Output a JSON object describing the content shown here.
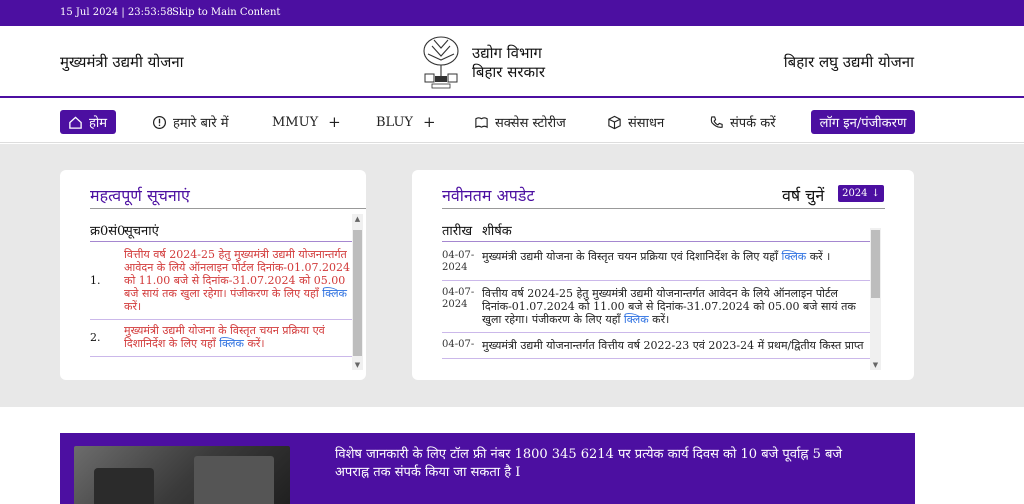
{
  "topbar": {
    "datetime": "15 Jul 2024 | 23:53:58",
    "skip_link": "Skip to Main Content"
  },
  "header": {
    "left_title": "मुख्यमंत्री उद्यमी योजना",
    "logo_line1": "उद्योग विभाग",
    "logo_line2": "बिहार सरकार",
    "right_title": "बिहार लघु उद्यमी योजना"
  },
  "nav": {
    "home": "होम",
    "about": "हमारे बारे में",
    "mmuy": "MMUY",
    "bluy": "BLUY",
    "success": "सक्सेस स्टोरीज",
    "resources": "संसाधन",
    "contact": "संपर्क करें",
    "login": "लॉग इन/पंजीकरण"
  },
  "notices": {
    "title": "महत्वपूर्ण सूचनाएं",
    "col_num": "क्र0सं0",
    "col_notice": "सूचनाएं",
    "items": [
      {
        "num": "1.",
        "text": "वित्तीय वर्ष 2024-25 हेतु मुख्यमंत्री उद्यमी योजनान्तर्गत आवेदन के लिये ऑनलाइन पोर्टल दिनांक-01.07.2024 को 11.00 बजे से दिनांक-31.07.2024 को 05.00 बजे सायं तक खुला रहेगा। पंजीकरण के लिए यहाँ",
        "link": "क्लिक",
        "after": "करें।"
      },
      {
        "num": "2.",
        "text": "मुख्यमंत्री उद्यमी योजना के विस्तृत चयन प्रक्रिया एवं दिशानिर्देश के लिए यहाँ",
        "link": "क्लिक",
        "after": "करें।"
      }
    ]
  },
  "updates": {
    "title": "नवीनतम अपडेट",
    "year_label": "वर्ष चुनें",
    "year_value": "2024",
    "col_date": "तारीख",
    "col_title": "शीर्षक",
    "items": [
      {
        "date": "04-07-2024",
        "text": "मुख्यमंत्री उद्यमी योजना के विस्तृत चयन प्रक्रिया एवं दिशानिर्देश के लिए यहाँ",
        "link": "क्लिक",
        "after": "करें ।"
      },
      {
        "date": "04-07-2024",
        "text": "वित्तीय वर्ष 2024-25 हेतु मुख्यमंत्री उद्यमी योजनान्तर्गत आवेदन के लिये ऑनलाइन पोर्टल दिनांक-01.07.2024 को 11.00 बजे से दिनांक-31.07.2024 को 05.00 बजे सायं तक खुला रहेगा। पंजीकरण के लिए यहाँ",
        "link": "क्लिक",
        "after": "करें।"
      },
      {
        "date": "04-07-",
        "text": "मुख्यमंत्री उद्यमी योजनान्तर्गत वित्तीय वर्ष 2022-23 एवं 2023-24 में प्रथम/द्वितीय किस्त प्राप्त",
        "link": "",
        "after": ""
      }
    ]
  },
  "banner": {
    "text": "विशेष जानकारी के लिए टॉल फ्री नंबर 1800 345 6214 पर प्रत्येक कार्य दिवस को 10 बजे पूर्वाह्न 5 बजे अपराह्न तक संपर्क किया जा सकता है I"
  },
  "colors": {
    "brand": "#4c0fa1",
    "notice_text": "#d23a3a",
    "link": "#2b6fe0"
  }
}
